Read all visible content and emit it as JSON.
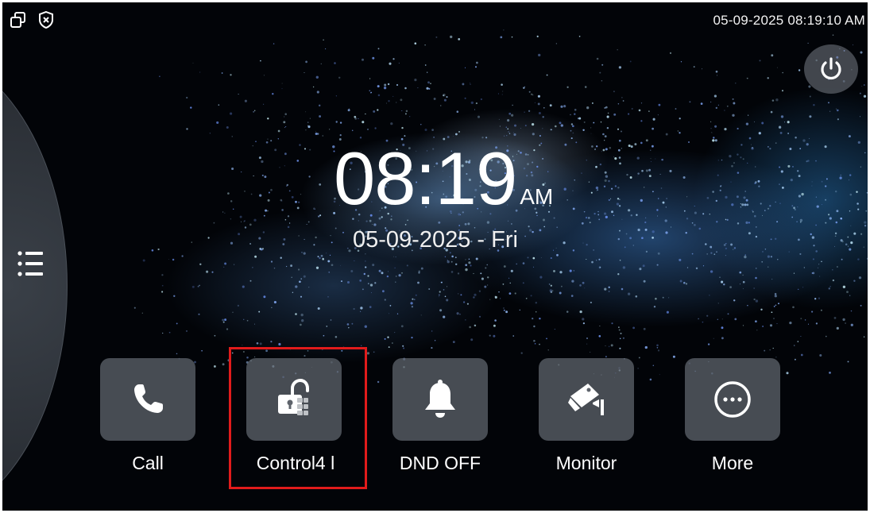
{
  "status_bar": {
    "datetime": "05-09-2025 08:19:10 AM",
    "icons": [
      "window-restore-icon",
      "shield-close-icon"
    ]
  },
  "clock": {
    "time": "08:19",
    "ampm": "AM",
    "date": "05-09-2025 - Fri"
  },
  "side_menu": {
    "icon": "list-menu-icon"
  },
  "power": {
    "icon": "power-icon"
  },
  "tiles": [
    {
      "label": "Call",
      "icon": "phone-icon"
    },
    {
      "label": "Control4 l",
      "icon": "unlock-icon"
    },
    {
      "label": "DND OFF",
      "icon": "bell-icon"
    },
    {
      "label": "Monitor",
      "icon": "camera-icon"
    },
    {
      "label": "More",
      "icon": "more-icon"
    }
  ],
  "colors": {
    "highlight": "#e11b1b",
    "tile_bg": "#5f646c",
    "accent_blue": "#4a86c8"
  }
}
